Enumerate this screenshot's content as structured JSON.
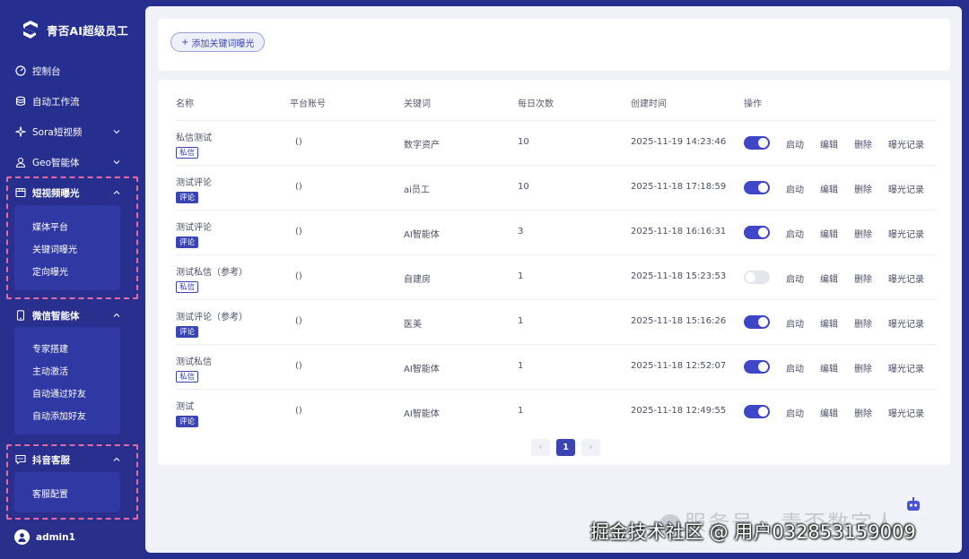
{
  "sidebar": {
    "brand": "青否AI超级员工",
    "items": {
      "console": "控制台",
      "workflow": "自动工作流",
      "sora": "Sora短视频",
      "geo": "Geo智能体",
      "short_video": "短视频曝光",
      "wechat": "微信智能体",
      "douyin": "抖音客服"
    },
    "short_video_sub": [
      "媒体平台",
      "关键词曝光",
      "定向曝光"
    ],
    "wechat_sub": [
      "专家搭建",
      "主动激活",
      "自动通过好友",
      "自动添加好友"
    ],
    "douyin_sub": [
      "客服配置"
    ],
    "user": "admin1"
  },
  "toolbar": {
    "add_label": "添加关键词曝光",
    "add_icon": "+"
  },
  "table": {
    "headers": [
      "名称",
      "平台账号",
      "关键词",
      "每日次数",
      "创建时间",
      "操作"
    ],
    "rows": [
      {
        "name": "私信测试",
        "tag": "私信",
        "tag_style": "outline",
        "account": "()",
        "keyword": "数字资产",
        "count": "10",
        "time": "2025-11-19 14:23:46",
        "enabled": true
      },
      {
        "name": "测试评论",
        "tag": "评论",
        "tag_style": "fill",
        "account": "()",
        "keyword": "ai员工",
        "count": "10",
        "time": "2025-11-18 17:18:59",
        "enabled": true
      },
      {
        "name": "测试评论",
        "tag": "评论",
        "tag_style": "fill",
        "account": "()",
        "keyword": "AI智能体",
        "count": "3",
        "time": "2025-11-18 16:16:31",
        "enabled": true
      },
      {
        "name": "测试私信（参考）",
        "tag": "私信",
        "tag_style": "outline",
        "account": "()",
        "keyword": "自建房",
        "count": "1",
        "time": "2025-11-18 15:23:53",
        "enabled": false
      },
      {
        "name": "测试评论（参考）",
        "tag": "评论",
        "tag_style": "fill",
        "account": "()",
        "keyword": "医美",
        "count": "1",
        "time": "2025-11-18 15:16:26",
        "enabled": true
      },
      {
        "name": "测试私信",
        "tag": "私信",
        "tag_style": "outline",
        "account": "()",
        "keyword": "AI智能体",
        "count": "1",
        "time": "2025-11-18 12:52:07",
        "enabled": true
      },
      {
        "name": "测试",
        "tag": "评论",
        "tag_style": "fill",
        "account": "()",
        "keyword": "AI智能体",
        "count": "1",
        "time": "2025-11-18 12:49:55",
        "enabled": true
      }
    ],
    "actions": [
      "启动",
      "编辑",
      "删除",
      "曝光记录"
    ]
  },
  "pagination": {
    "prev": "‹",
    "current": "1",
    "next": "›"
  },
  "watermark": {
    "line1": "服务号 · 青否数字人",
    "line2": "掘金技术社区 @ 用户032853159009"
  },
  "colors": {
    "sidebar": "#272f8e",
    "accent": "#3a44b3",
    "highlight_border": "#e36aa7"
  }
}
